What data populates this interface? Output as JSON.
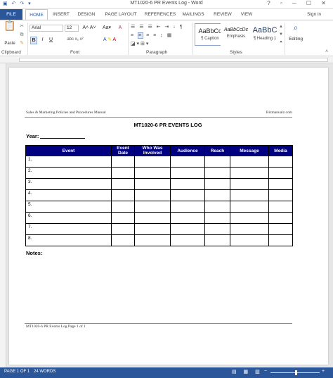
{
  "window": {
    "title": "MT1020-6 PR Events Log - Word"
  },
  "tabs": [
    "FILE",
    "HOME",
    "INSERT",
    "DESIGN",
    "PAGE LAYOUT",
    "REFERENCES",
    "MAILINGS",
    "REVIEW",
    "VIEW"
  ],
  "active_tab": "HOME",
  "signin": "Sign in",
  "ribbon": {
    "groups": [
      "Clipboard",
      "Font",
      "Paragraph",
      "Styles"
    ],
    "font_name": "Arial",
    "font_size": "12",
    "bold": "B",
    "italic": "I",
    "underline": "U",
    "styles": [
      {
        "preview": "AaBbCc",
        "name": "¶ Caption"
      },
      {
        "preview": "AaBbCcDc",
        "name": "Emphasis"
      },
      {
        "preview": "AaBbC",
        "name": "¶ Heading 1"
      }
    ],
    "editing": "Editing"
  },
  "document": {
    "header_left": "Sales & Marketing Policies and Procedures Manual",
    "header_right": "Bizmanualz.com",
    "title": "MT1020-6 PR EVENTS LOG",
    "year_label": "Year:",
    "table": {
      "columns": [
        "Event",
        "Event Date",
        "Who Was Involved",
        "Audience",
        "Reach",
        "Message",
        "Media"
      ],
      "rows": [
        "1.",
        "2.",
        "3.",
        "4.",
        "5.",
        "6.",
        "7.",
        "8."
      ]
    },
    "notes_label": "Notes:",
    "footer": "MT1020-6 PR Events Log Page 1 of 1"
  },
  "status": {
    "page": "PAGE 1 OF 1",
    "words": "24 WORDS"
  },
  "colors": {
    "accent": "#2b579a",
    "table_header": "#000080"
  }
}
